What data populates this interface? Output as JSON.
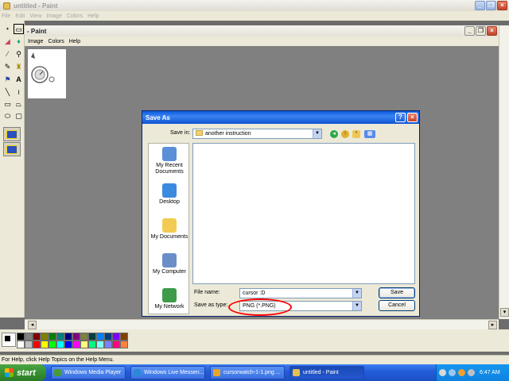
{
  "window": {
    "title": "untitled - Paint",
    "menu": [
      "File",
      "Edit",
      "View",
      "Image",
      "Colors",
      "Help"
    ]
  },
  "child": {
    "title": "- Paint",
    "menu": [
      "Image",
      "Colors",
      "Help"
    ]
  },
  "dialog": {
    "title": "Save As",
    "save_in_label": "Save in:",
    "save_in_value": "another instruction",
    "places": [
      {
        "label": "My Recent Documents",
        "icon": "recent-documents-icon"
      },
      {
        "label": "Desktop",
        "icon": "desktop-icon"
      },
      {
        "label": "My Documents",
        "icon": "my-documents-icon"
      },
      {
        "label": "My Computer",
        "icon": "my-computer-icon"
      },
      {
        "label": "My Network",
        "icon": "my-network-icon"
      }
    ],
    "file_name_label": "File name:",
    "file_name_value": "cursor :D",
    "save_as_type_label": "Save as type:",
    "save_as_type_value": "PNG (*.PNG)",
    "save_button": "Save",
    "cancel_button": "Cancel"
  },
  "palette": {
    "colors": [
      "#000000",
      "#808080",
      "#800000",
      "#808000",
      "#008000",
      "#008080",
      "#000080",
      "#800080",
      "#808040",
      "#004040",
      "#0080ff",
      "#004080",
      "#8000ff",
      "#804000",
      "#ffffff",
      "#c0c0c0",
      "#ff0000",
      "#ffff00",
      "#00ff00",
      "#00ffff",
      "#0000ff",
      "#ff00ff",
      "#ffff80",
      "#00ff80",
      "#80ffff",
      "#8080ff",
      "#ff0080",
      "#ff8040"
    ]
  },
  "status": {
    "text": "For Help, click Help Topics on the Help Menu."
  },
  "taskbar": {
    "start": "start",
    "tasks": [
      {
        "label": "Windows Media Player",
        "color": "#4a9a3a"
      },
      {
        "label": "Windows Live Messen...",
        "color": "#2a8ad8"
      },
      {
        "label": "cursorwatch-1-1.png ...",
        "color": "#e8a628"
      },
      {
        "label": "untitled - Paint",
        "color": "#e5c04f"
      }
    ],
    "clock": "6:47 AM"
  },
  "colors": {
    "annotation": "#ff0000",
    "title_blue": "#0a5ade"
  }
}
